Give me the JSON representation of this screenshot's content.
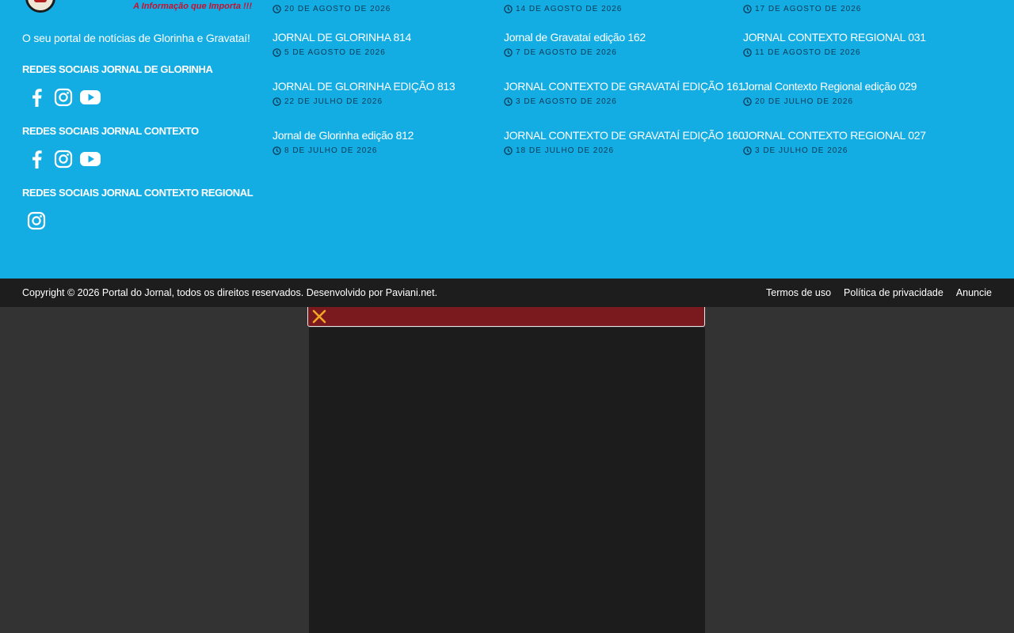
{
  "logo": {
    "tagline": "A Informação que Importa !!!"
  },
  "about": "O seu portal de notícias de Glorinha e Gravataí!",
  "social_sections": [
    {
      "title": "REDES SOCIAIS JORNAL DE GLORINHA",
      "icons": [
        "facebook-icon",
        "instagram-icon",
        "youtube-icon"
      ]
    },
    {
      "title": "REDES SOCIAIS JORNAL CONTEXTO",
      "icons": [
        "facebook-icon",
        "instagram-icon",
        "youtube-icon"
      ]
    },
    {
      "title": "REDES SOCIAIS JORNAL CONTEXTO REGIONAL",
      "icons": [
        "instagram-icon"
      ]
    }
  ],
  "columns": [
    {
      "top_date": "20 DE AGOSTO DE 2026",
      "posts": [
        {
          "title": "JORNAL DE GLORINHA 814",
          "date": "5 DE AGOSTO DE 2026"
        },
        {
          "title": "JORNAL DE GLORINHA EDIÇÃO 813",
          "date": "22 DE JULHO DE 2026"
        },
        {
          "title": "Jornal de Glorinha edição 812",
          "date": "8 DE JULHO DE 2026"
        }
      ]
    },
    {
      "top_date": "14 DE AGOSTO DE 2026",
      "posts": [
        {
          "title": "Jornal de Gravataí edição 162",
          "date": "7 DE AGOSTO DE 2026"
        },
        {
          "title": "JORNAL CONTEXTO DE GRAVATAÍ EDIÇÃO 161",
          "date": "3 DE AGOSTO DE 2026"
        },
        {
          "title": "JORNAL CONTEXTO DE GRAVATAÍ EDIÇÃO 160",
          "date": "18 DE JULHO DE 2026"
        }
      ]
    },
    {
      "top_date": "17 DE AGOSTO DE 2026",
      "posts": [
        {
          "title": "JORNAL CONTEXTO REGIONAL 031",
          "date": "11 DE AGOSTO DE 2026"
        },
        {
          "title": "Jornal Contexto Regional edição 029",
          "date": "20 DE JULHO DE 2026"
        },
        {
          "title": "JORNAL CONTEXTO REGIONAL 027",
          "date": "3 DE JULHO DE 2026"
        }
      ]
    }
  ],
  "bottom": {
    "copyright": "Copyright © 2026 Portal do Jornal, todos os direitos reservados. Desenvolvido por Paviani.net.",
    "links": [
      "Termos de uso",
      "Política de privacidade",
      "Anuncie"
    ]
  },
  "colors": {
    "footer_bg": "#13ade4",
    "bottom_bar_bg": "#1d1d1d",
    "page_bg": "#333333",
    "ad_bar_bg": "#7a1a1e",
    "close_icon": "#f5a623"
  },
  "ad": {
    "close_icon": "close-icon"
  }
}
